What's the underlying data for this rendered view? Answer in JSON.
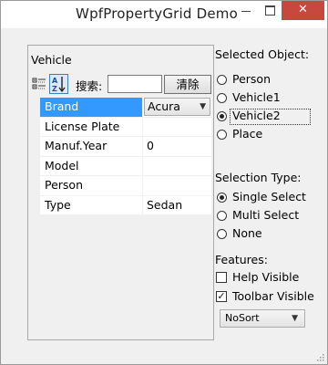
{
  "window": {
    "title": "WpfPropertyGrid Demo",
    "close_glyph": "✕"
  },
  "grid": {
    "header": "Vehicle",
    "toolbar": {
      "categorized_icon": "categorized-icon",
      "alphabetical_icon": "sort-az-icon",
      "search_label": "搜索:",
      "search_value": "",
      "clear_label": "清除"
    },
    "properties": [
      {
        "name": "Brand",
        "value": "Acura",
        "selected": true,
        "editor": "combo"
      },
      {
        "name": "License Plate",
        "value": ""
      },
      {
        "name": "Manuf.Year",
        "value": "0"
      },
      {
        "name": "Model",
        "value": ""
      },
      {
        "name": "Person",
        "value": ""
      },
      {
        "name": "Type",
        "value": "Sedan"
      }
    ]
  },
  "selected_object": {
    "heading": "Selected Object:",
    "options": [
      "Person",
      "Vehicle1",
      "Vehicle2",
      "Place"
    ],
    "selected": "Vehicle2"
  },
  "selection_type": {
    "heading": "Selection Type:",
    "options": [
      "Single Select",
      "Multi Select",
      "None"
    ],
    "selected": "Single Select"
  },
  "features": {
    "heading": "Features:",
    "help_visible": {
      "label": "Help Visible",
      "checked": false
    },
    "toolbar_visible": {
      "label": "Toolbar Visible",
      "checked": true
    },
    "sort_mode": "NoSort"
  }
}
